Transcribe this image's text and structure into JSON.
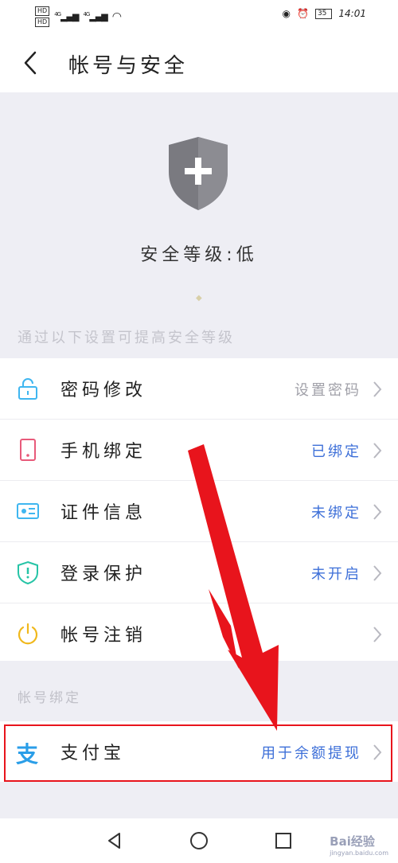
{
  "status_bar": {
    "hd1": "HD",
    "hd2": "HD",
    "net1": "4G",
    "net2": "4G",
    "battery": "35",
    "time": "14:01"
  },
  "header": {
    "title": "帐号与安全",
    "back_icon": "chevron-left-icon"
  },
  "security": {
    "icon": "shield-plus-icon",
    "level_text": "安全等级:低",
    "hint": "通过以下设置可提高安全等级"
  },
  "items": [
    {
      "label": "密码修改",
      "value": "设置密码",
      "icon": "lock-icon",
      "color": "#3fb6f0",
      "muted": true
    },
    {
      "label": "手机绑定",
      "value": "已绑定",
      "icon": "phone-icon",
      "color": "#e85a7a",
      "muted": false
    },
    {
      "label": "证件信息",
      "value": "未绑定",
      "icon": "id-card-icon",
      "color": "#3fb6f0",
      "muted": false
    },
    {
      "label": "登录保护",
      "value": "未开启",
      "icon": "shield-alert-icon",
      "color": "#26c4a6",
      "muted": false
    },
    {
      "label": "帐号注销",
      "value": "",
      "icon": "power-icon",
      "color": "#f0b81c",
      "muted": false
    }
  ],
  "binding": {
    "caption": "帐号绑定",
    "alipay_label": "支付宝",
    "alipay_glyph": "支",
    "alipay_value": "用于余额提现"
  },
  "nav": {
    "back": "triangle-back-icon",
    "home": "circle-home-icon",
    "recent": "square-recent-icon"
  },
  "watermark": {
    "brand": "Bai经验",
    "url": "jingyan.baidu.com"
  },
  "colors": {
    "accent": "#3d6fd8",
    "highlight": "#e8141c",
    "section_bg": "#eeeef4"
  }
}
